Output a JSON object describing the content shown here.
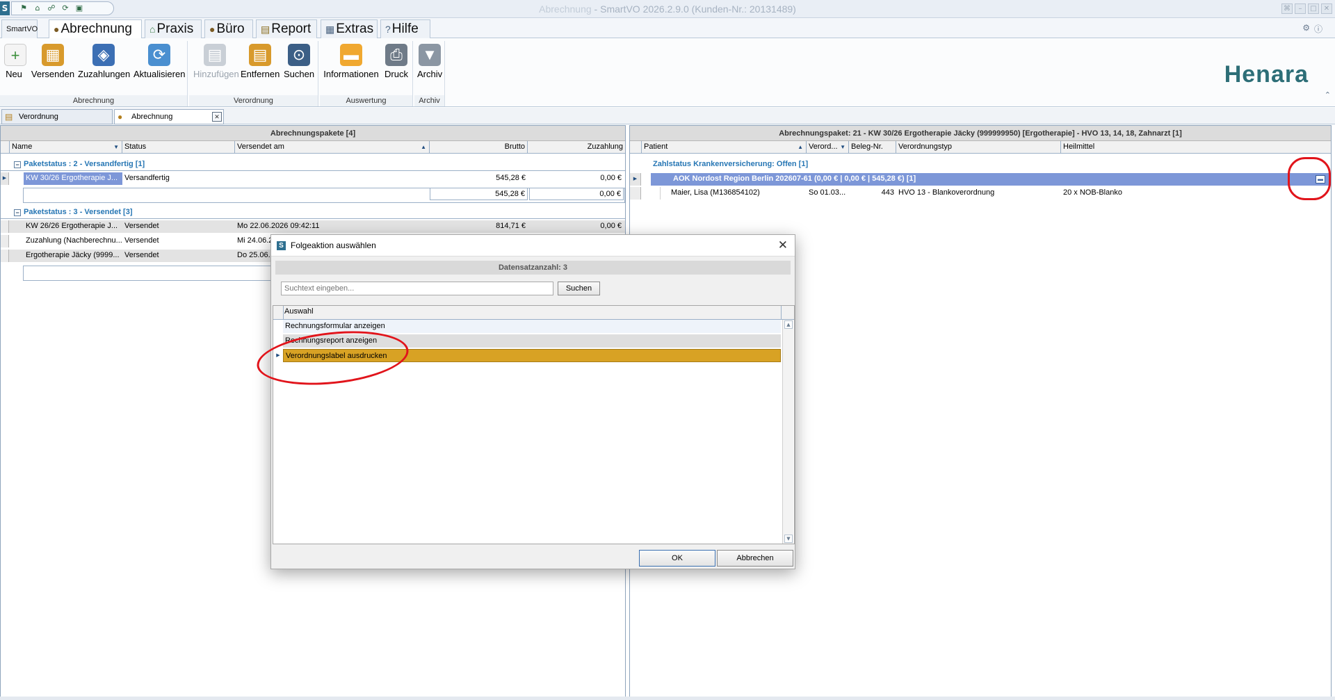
{
  "window": {
    "title_doc": "Abrechnung",
    "title_sep": " - ",
    "title_app": "SmartVO 2026.2.9.0 (Kunden-Nr.: 20131489)",
    "app_letter": "S"
  },
  "ribbon_tabs": [
    {
      "label": "SmartVO"
    },
    {
      "label": "Abrechnung"
    },
    {
      "label": "Praxis"
    },
    {
      "label": "Büro"
    },
    {
      "label": "Report"
    },
    {
      "label": "Extras"
    },
    {
      "label": "Hilfe"
    }
  ],
  "ribbon": {
    "groups": [
      {
        "label": "Abrechnung",
        "buttons": [
          "Neu",
          "Versenden",
          "Zuzahlungen",
          "Aktualisieren"
        ]
      },
      {
        "label": "Verordnung",
        "buttons": [
          "Hinzufügen",
          "Entfernen",
          "Suchen"
        ]
      },
      {
        "label": "Auswertung",
        "buttons": [
          "Informationen",
          "Druck"
        ]
      },
      {
        "label": "Archiv",
        "buttons": [
          "Archiv"
        ]
      }
    ],
    "logo": "Henara"
  },
  "doc_tabs": [
    {
      "label": "Verordnung"
    },
    {
      "label": "Abrechnung"
    }
  ],
  "left_panel": {
    "title": "Abrechnungspakete [4]",
    "columns": [
      "Name",
      "Status",
      "Versendet am",
      "Brutto",
      "Zuzahlung"
    ],
    "group1": {
      "label": "Paketstatus : 2 - Versandfertig [1]"
    },
    "group1_rows": [
      {
        "name": "KW 30/26  Ergotherapie J...",
        "status": "Versandfertig",
        "date": "",
        "brutto": "545,28 €",
        "zuz": "0,00 €"
      }
    ],
    "group1_sum": {
      "brutto": "545,28 €",
      "zuz": "0,00 €"
    },
    "group2": {
      "label": "Paketstatus : 3 - Versendet [3]"
    },
    "group2_rows": [
      {
        "name": "KW 26/26  Ergotherapie J...",
        "status": "Versendet",
        "date": "Mo 22.06.2026 09:42:11",
        "brutto": "814,71 €",
        "zuz": "0,00 €"
      },
      {
        "name": "Zuzahlung (Nachberechnu...",
        "status": "Versendet",
        "date": "Mi 24.06.2",
        "brutto": "",
        "zuz": ""
      },
      {
        "name": "Ergotherapie Jäcky (9999...",
        "status": "Versendet",
        "date": "Do 25.06.",
        "brutto": "",
        "zuz": ""
      }
    ]
  },
  "right_panel": {
    "title": "Abrechnungspaket: 21 - KW 30/26  Ergotherapie Jäcky (999999950) [Ergotherapie] - HVO 13, 14, 18, Zahnarzt [1]",
    "columns": [
      "Patient",
      "Verord...",
      "Beleg-Nr.",
      "Verordnungstyp",
      "Heilmittel"
    ],
    "group": {
      "label": "Zahlstatus Krankenversicherung: Offen [1]"
    },
    "subgroup": {
      "label": "AOK Nordost Region Berlin 202607-61 (0,00 € | 0,00 € | 545,28 €) [1]"
    },
    "row": {
      "patient": "Maier, Lisa (M136854102)",
      "verord": "So 01.03...",
      "beleg": "443",
      "typ": "HVO 13 - Blankoverordnung",
      "heilmittel": "20 x NOB-Blanko"
    }
  },
  "dialog": {
    "title": "Folgeaktion auswählen",
    "count": "Datensatzanzahl: 3",
    "search_placeholder": "Suchtext eingeben...",
    "search_button": "Suchen",
    "list_header": "Auswahl",
    "items": [
      "Rechnungsformular anzeigen",
      "Rechnungsreport anzeigen",
      "Verordnungslabel ausdrucken"
    ],
    "selected_index": 2,
    "ok": "OK",
    "cancel": "Abbrechen"
  },
  "colors": {
    "selection": "#d8a224",
    "group_text": "#2676b4",
    "subgroup_bg": "#7d97d8",
    "annotation": "#e1141b"
  }
}
